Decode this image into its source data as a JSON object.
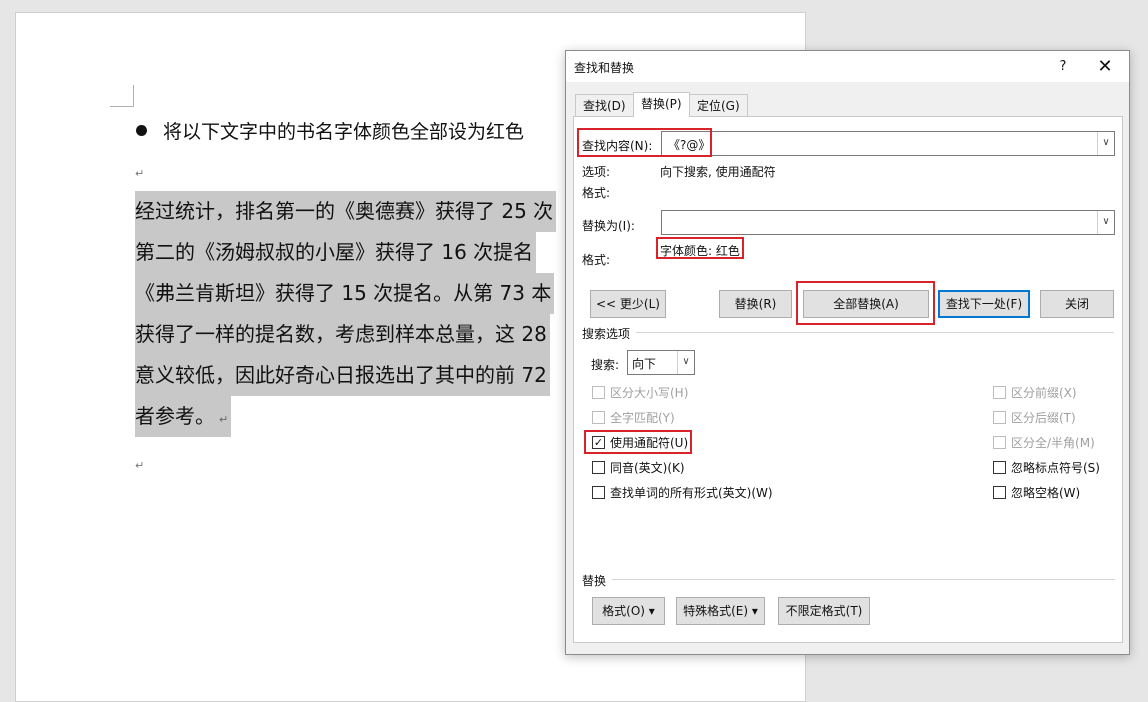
{
  "document": {
    "bullet_text": "将以下文字中的书名字体颜色全部设为红色",
    "paragraph_mark": "↵",
    "lines": [
      "经过统计，排名第一的《奥德赛》获得了 25 次",
      "第二的《汤姆叔叔的小屋》获得了 16 次提名",
      "《弗兰肯斯坦》获得了 15 次提名。从第 73 本",
      "获得了一样的提名数，考虑到样本总量，这 28",
      "意义较低，因此好奇心日报选出了其中的前 72",
      "者参考。"
    ]
  },
  "dialog": {
    "title": "查找和替换",
    "help": "?",
    "close": "✕",
    "tabs": [
      "查找(D)",
      "替换(P)",
      "定位(G)"
    ],
    "find_label": "查找内容(N):",
    "find_value": "《?@》",
    "options_label": "选项:",
    "options_value": "向下搜索, 使用通配符",
    "format_label_find": "格式:",
    "replace_label": "替换为(I):",
    "replace_value": "",
    "format_label_replace": "格式:",
    "replace_format_value": "字体颜色: 红色",
    "buttons": {
      "less": "<< 更少(L)",
      "replace": "替换(R)",
      "replace_all": "全部替换(A)",
      "find_next": "查找下一处(F)",
      "close": "关闭"
    },
    "search_options_title": "搜索选项",
    "search_label": "搜索:",
    "search_value": "向下",
    "checkboxes_left": [
      {
        "label": "区分大小写(H)",
        "checked": false,
        "enabled": false
      },
      {
        "label": "全字匹配(Y)",
        "checked": false,
        "enabled": false
      },
      {
        "label": "使用通配符(U)",
        "checked": true,
        "enabled": true
      },
      {
        "label": "同音(英文)(K)",
        "checked": false,
        "enabled": true
      },
      {
        "label": "查找单词的所有形式(英文)(W)",
        "checked": false,
        "enabled": true
      }
    ],
    "checkboxes_right": [
      {
        "label": "区分前缀(X)",
        "checked": false,
        "enabled": false
      },
      {
        "label": "区分后缀(T)",
        "checked": false,
        "enabled": false
      },
      {
        "label": "区分全/半角(M)",
        "checked": false,
        "enabled": false
      },
      {
        "label": "忽略标点符号(S)",
        "checked": false,
        "enabled": true
      },
      {
        "label": "忽略空格(W)",
        "checked": false,
        "enabled": true
      }
    ],
    "replace_section_title": "替换",
    "bottom_buttons": {
      "format": "格式(O) ▾",
      "special": "特殊格式(E) ▾",
      "no_format": "不限定格式(T)"
    },
    "check_mark": "✓",
    "combo_arrow": "∨",
    "highlight_color": "#d9222a",
    "accent_color": "#0078d7"
  }
}
